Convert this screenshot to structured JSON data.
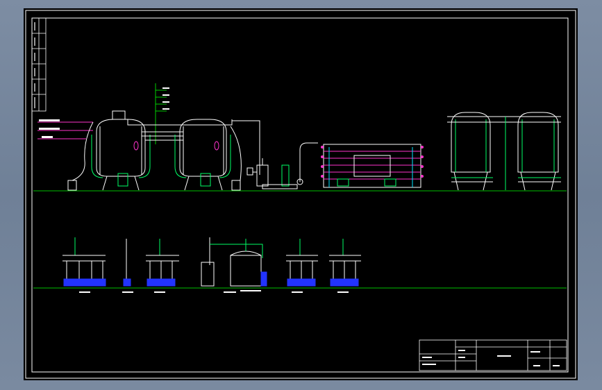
{
  "drawing": {
    "background": "#000000",
    "frame_color": "#ffffff",
    "colors": {
      "ground": "#00c000",
      "pipe_white": "#ffffff",
      "pipe_green": "#00ff66",
      "pipe_cyan": "#00e5ff",
      "pipe_magenta": "#ff33cc",
      "pipe_yellow": "#ffff00",
      "pump_blue": "#2233ff",
      "leader_green": "#00ff00"
    },
    "icons": {
      "filter_vessel": "filter-tank-icon",
      "pump": "pump-icon",
      "ro_unit": "reverse-osmosis-rack-icon",
      "storage_tank": "storage-tank-icon"
    }
  }
}
